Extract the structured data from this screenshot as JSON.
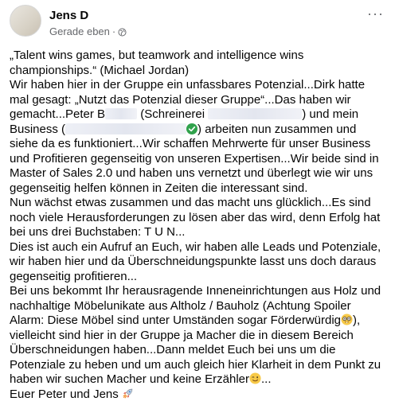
{
  "post": {
    "author": "Jens D",
    "timestamp": "Gerade eben",
    "separator": "·",
    "more_label": "···",
    "privacy_icon": "globe-icon"
  },
  "content": {
    "p1": "„Talent wins games, but teamwork and intelligence wins championships.“ (Michael Jordan)",
    "p2_a": "Wir haben hier in der Gruppe ein unfassbares Potenzial...Dirk hatte mal gesagt: „Nutzt das Potenzial dieser Gruppe“...Das haben wir gemacht...Peter B",
    "p2_b": " (Schreinerei ",
    "p2_c": ") und mein Business (",
    "p2_d": ") arbeiten nun zusammen und siehe da es funktioniert...Wir schaffen Mehrwerte für unser Business und Profitieren gegenseitig von unseren Expertisen...Wir beide sind in Master of Sales 2.0 und haben uns vernetzt und überlegt wie wir uns gegenseitig helfen können in Zeiten die interessant sind.",
    "p3": "Nun wächst etwas zusammen und das macht uns glücklich...Es sind noch viele Herausforderungen zu lösen aber das wird, denn Erfolg hat bei uns drei Buchstaben: T U N...",
    "p4": "Dies ist auch ein Aufruf an Euch, wir haben alle Leads und Potenziale, wir haben hier und da Überschneidungspunkte lasst uns doch daraus gegenseitig profitieren...",
    "p5_a": "Bei uns bekommt Ihr herausragende Inneneinrichtungen aus Holz und nachhaltige Möbelunikate aus Altholz / Bauholz (Achtung Spoiler Alarm: Diese Möbel sind unter Umständen sogar Förderwürdig",
    "p5_b": "), vielleicht sind hier in der Gruppe ja Macher die in diesem Bereich Überschneidungen haben...Dann meldet Euch bei uns um die Potenziale zu heben und um auch gleich hier Klarheit in dem Punkt zu haben wir suchen Macher und keine Erzähler",
    "p5_c": "...",
    "p6": "Euer Peter und Jens "
  },
  "icons": {
    "verified": "verified-check-icon",
    "nerd_emoji": "nerd-face-emoji-icon",
    "wink_emoji": "winking-face-emoji-icon",
    "rocket_emoji": "rocket-emoji-icon"
  },
  "colors": {
    "text": "#050505",
    "secondary": "#65676b",
    "verified": "#31a24c"
  }
}
